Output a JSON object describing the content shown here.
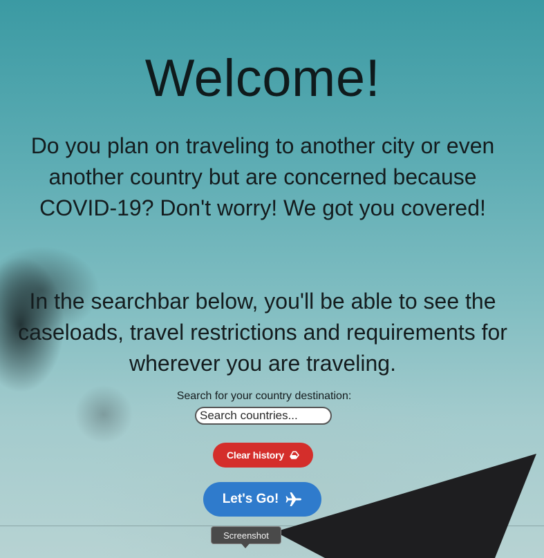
{
  "page": {
    "title": "Welcome!",
    "intro": "Do you plan on traveling to another city or even another country but are concerned because COVID-19? Don't worry! We got you covered!",
    "instructions": "In the searchbar below, you'll be able to see the caseloads, travel restrictions and requirements for wherever you are traveling."
  },
  "search": {
    "label": "Search for your country destination:",
    "placeholder": "Search countries...",
    "value": ""
  },
  "buttons": {
    "clear_history_label": "Clear history",
    "clear_history_icon": "eraser-icon",
    "go_label": "Let's Go!",
    "go_icon": "airplane-icon"
  },
  "tooltip": {
    "text": "Screenshot"
  },
  "colors": {
    "clear_button": "#d42e2b",
    "go_button": "#2f7bcc",
    "pointer_overlay": "#1e1e20"
  }
}
